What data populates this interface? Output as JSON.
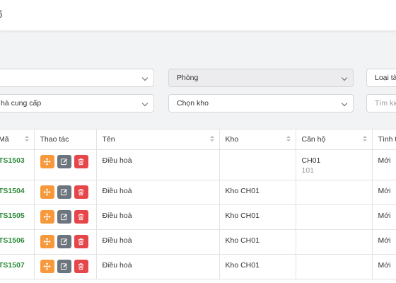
{
  "header": {
    "title": "ổ"
  },
  "filters": {
    "row1": {
      "left_select": "",
      "room_select": "Phòng",
      "type_select": "Loại tà"
    },
    "row2": {
      "supplier_select": "hà cung cấp",
      "warehouse_select": "Chọn kho",
      "search_placeholder": "Tìm kiế"
    }
  },
  "table": {
    "columns": [
      "Mã",
      "Thao tác",
      "Tên",
      "Kho",
      "Căn hộ",
      "Tình t"
    ],
    "rows": [
      {
        "code": "TS1503",
        "name": "Điều hoà",
        "warehouse": "",
        "apartment": "CH01",
        "apartment_sub": "101",
        "status": "Mới"
      },
      {
        "code": "TS1504",
        "name": "Điều hoà",
        "warehouse": "Kho CH01",
        "apartment": "",
        "apartment_sub": "",
        "status": "Mới"
      },
      {
        "code": "TS1505",
        "name": "Điều hoà",
        "warehouse": "Kho CH01",
        "apartment": "",
        "apartment_sub": "",
        "status": "Mới"
      },
      {
        "code": "TS1506",
        "name": "Điều hoà",
        "warehouse": "Kho CH01",
        "apartment": "",
        "apartment_sub": "",
        "status": "Mới"
      },
      {
        "code": "TS1507",
        "name": "Điều hoà",
        "warehouse": "Kho CH01",
        "apartment": "",
        "apartment_sub": "",
        "status": "Mới"
      }
    ],
    "action_icons": [
      "move-icon",
      "edit-icon",
      "trash-icon"
    ],
    "colors": {
      "code": "#2e8b3b",
      "move": "#f7983a",
      "edit": "#6c757d",
      "delete": "#e6454a"
    }
  }
}
